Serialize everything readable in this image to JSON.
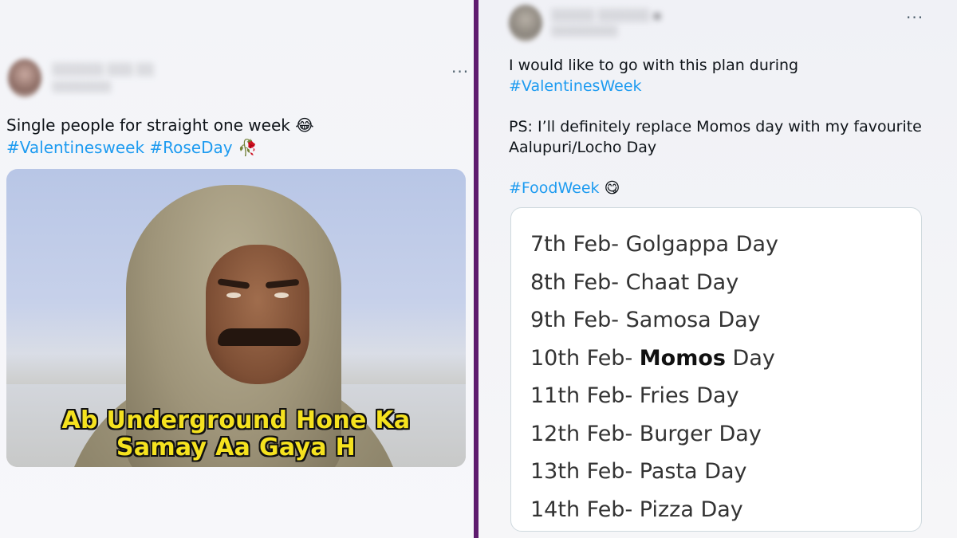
{
  "left_tweet": {
    "text_line1": "Single people for straight one week",
    "emoji1": "😂",
    "hashtag1": "#Valentinesweek",
    "hashtag2": "#RoseDay",
    "emoji2": "🥀",
    "more_label": "···",
    "meme": {
      "caption_line1": "Ab Underground Hone Ka",
      "caption_line2": "Samay Aa Gaya H"
    }
  },
  "right_tweet": {
    "text_line1": "I would like to go with this plan during",
    "hashtag1": "#ValentinesWeek",
    "ps_line1": "PS: I’ll definitely replace Momos day with my favourite",
    "ps_line2": "Aalupuri/Locho Day",
    "hashtag2": "#FoodWeek",
    "emoji": "😋",
    "more_label": "···",
    "food_week": [
      {
        "date": "7th Feb-",
        "food": "Golgappa",
        "suffix": "Day",
        "bold": false
      },
      {
        "date": "8th Feb-",
        "food": "Chaat",
        "suffix": "Day",
        "bold": false
      },
      {
        "date": "9th Feb-",
        "food": "Samosa",
        "suffix": "Day",
        "bold": false
      },
      {
        "date": "10th Feb-",
        "food": "Momos",
        "suffix": "Day",
        "bold": true
      },
      {
        "date": "11th Feb-",
        "food": "Fries",
        "suffix": "Day",
        "bold": false
      },
      {
        "date": "12th Feb-",
        "food": "Burger",
        "suffix": "Day",
        "bold": false
      },
      {
        "date": "13th Feb-",
        "food": "Pasta",
        "suffix": "Day",
        "bold": false
      },
      {
        "date": "14th Feb-",
        "food": "Pizza",
        "suffix": "Day",
        "bold": false
      }
    ]
  },
  "colors": {
    "hashtag": "#1d9bf0",
    "divider": "#5e1b6e",
    "caption": "#f5e21f"
  }
}
